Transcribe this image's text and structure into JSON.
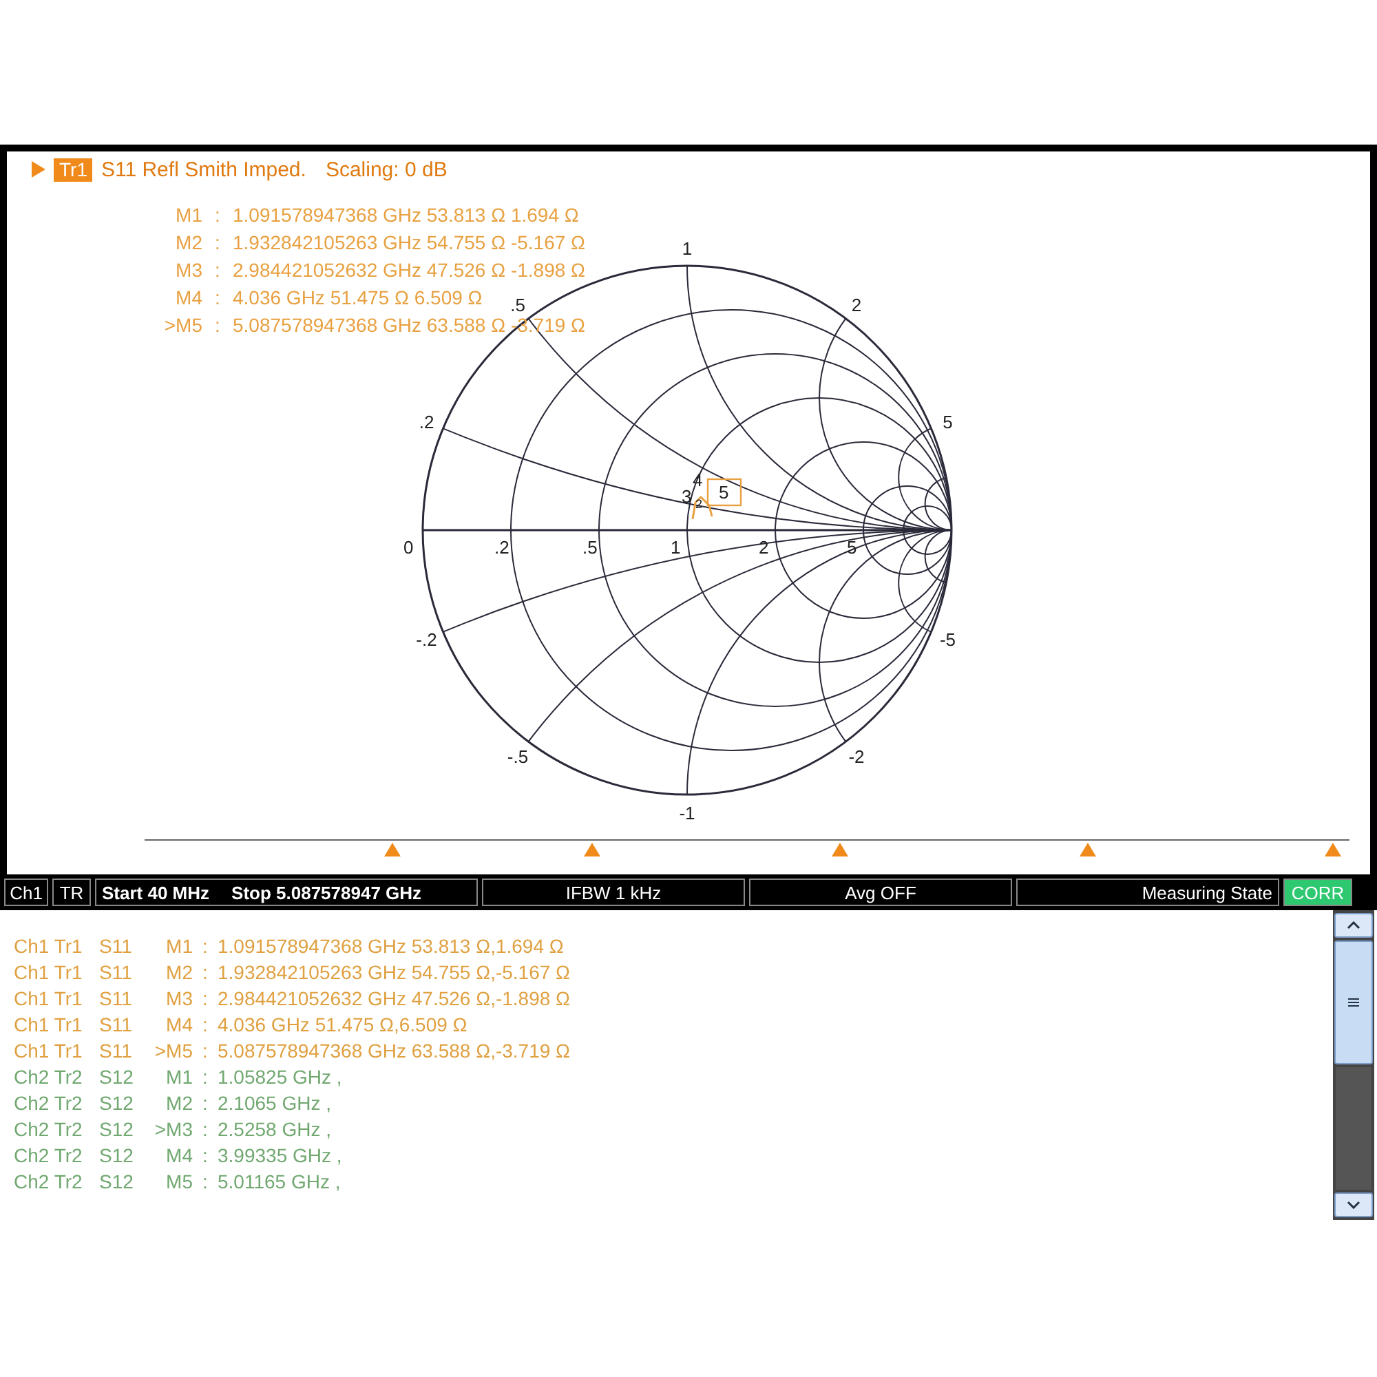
{
  "trace_header": {
    "trace": "Tr1",
    "title": "S11 Refl Smith Imped.",
    "scaling": "Scaling: 0 dB"
  },
  "marker_readouts": [
    {
      "marker": "M1",
      "sep": ":",
      "value": "1.091578947368 GHz 53.813  Ω  1.694  Ω"
    },
    {
      "marker": "M2",
      "sep": ":",
      "value": "1.932842105263 GHz 54.755  Ω  -5.167  Ω"
    },
    {
      "marker": "M3",
      "sep": ":",
      "value": "2.984421052632 GHz 47.526  Ω  -1.898  Ω"
    },
    {
      "marker": "M4",
      "sep": ":",
      "value": "4.036 GHz 51.475  Ω  6.509  Ω"
    },
    {
      "marker": ">M5",
      "sep": ":",
      "value": "5.087578947368 GHz 63.588  Ω  -3.719  Ω"
    }
  ],
  "smith_chart": {
    "resistance_labels": [
      "0",
      ".2",
      ".5",
      "1",
      "2",
      "5"
    ],
    "reactance_labels": [
      ".2",
      ".5",
      "1",
      "2",
      "5",
      "-.2",
      "-.5",
      "-1",
      "-2",
      "-5"
    ],
    "marker_labels": [
      {
        "text": "4",
        "selected": false
      },
      {
        "text": "3",
        "selected": false
      },
      {
        "text": "2",
        "selected": false
      },
      {
        "text": "5",
        "selected": true
      }
    ]
  },
  "status_bar": [
    {
      "kind": "tag",
      "text": "Ch1"
    },
    {
      "kind": "tag",
      "text": "TR"
    },
    {
      "kind": "sweep",
      "start": "Start 40 MHz",
      "stop": "Stop 5.087578947 GHz"
    },
    {
      "kind": "field",
      "text": "IFBW 1 kHz"
    },
    {
      "kind": "field",
      "text": "Avg OFF"
    },
    {
      "kind": "state",
      "text": "Measuring State"
    },
    {
      "kind": "badge",
      "text": "CORR"
    }
  ],
  "marker_table": [
    {
      "source": "Ch1 Tr1",
      "param": "S11",
      "marker": "M1",
      "sep": ":",
      "value": "1.091578947368 GHz 53.813  Ω,1.694  Ω",
      "color": "#e0a040"
    },
    {
      "source": "Ch1 Tr1",
      "param": "S11",
      "marker": "M2",
      "sep": ":",
      "value": "1.932842105263 GHz 54.755  Ω,-5.167  Ω",
      "color": "#e0a040"
    },
    {
      "source": "Ch1 Tr1",
      "param": "S11",
      "marker": "M3",
      "sep": ":",
      "value": "2.984421052632 GHz 47.526  Ω,-1.898  Ω",
      "color": "#e0a040"
    },
    {
      "source": "Ch1 Tr1",
      "param": "S11",
      "marker": "M4",
      "sep": ":",
      "value": "4.036 GHz 51.475  Ω,6.509  Ω",
      "color": "#e0a040"
    },
    {
      "source": "Ch1 Tr1",
      "param": "S11",
      "marker": ">M5",
      "sep": ":",
      "value": "5.087578947368 GHz 63.588  Ω,-3.719  Ω",
      "color": "#e0a040"
    },
    {
      "source": "Ch2 Tr2",
      "param": "S12",
      "marker": "M1",
      "sep": ":",
      "value": "1.05825 GHz ,",
      "color": "#70a870"
    },
    {
      "source": "Ch2 Tr2",
      "param": "S12",
      "marker": "M2",
      "sep": ":",
      "value": "2.1065 GHz ,",
      "color": "#70a870"
    },
    {
      "source": "Ch2 Tr2",
      "param": "S12",
      "marker": ">M3",
      "sep": ":",
      "value": "2.5258 GHz ,",
      "color": "#70a870"
    },
    {
      "source": "Ch2 Tr2",
      "param": "S12",
      "marker": "M4",
      "sep": ":",
      "value": "3.99335 GHz ,",
      "color": "#70a870"
    },
    {
      "source": "Ch2 Tr2",
      "param": "S12",
      "marker": "M5",
      "sep": ":",
      "value": "5.01165 GHz ,",
      "color": "#70a870"
    }
  ]
}
